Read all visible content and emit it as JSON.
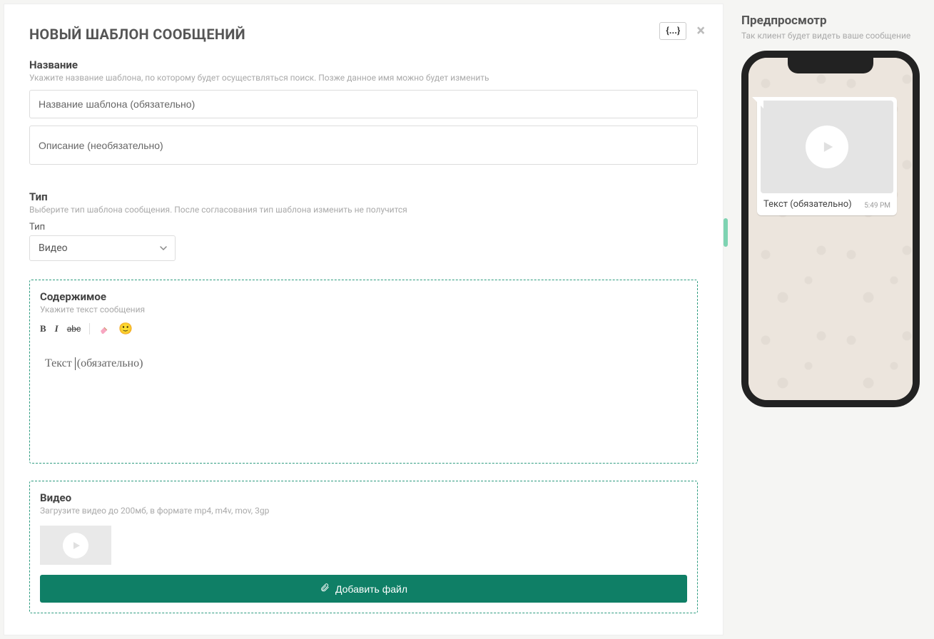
{
  "header": {
    "title": "НОВЫЙ ШАБЛОН СООБЩЕНИЙ",
    "json_button": "{...}"
  },
  "name_section": {
    "label": "Название",
    "hint": "Укажите название шаблона, по которому будет осуществляться поиск. Позже данное имя можно будет изменить",
    "placeholder": "Название шаблона (обязательно)",
    "desc_placeholder": "Описание (необязательно)"
  },
  "type_section": {
    "label": "Тип",
    "hint": "Выберите тип шаблона сообщения. После согласования тип шаблона изменить не получится",
    "select_label": "Тип",
    "value": "Видео"
  },
  "content_section": {
    "label": "Содержимое",
    "hint": "Укажите текст сообщения",
    "placeholder": "Текст (обязательно)",
    "toolbar": {
      "bold": "B",
      "italic": "I",
      "strike": "abc"
    }
  },
  "video_section": {
    "label": "Видео",
    "hint": "Загрузите видео до 200мб, в формате mp4, m4v, mov, 3gp",
    "button": "Добавить файл"
  },
  "preview": {
    "title": "Предпросмотр",
    "hint": "Так клиент будет видеть ваше сообщение",
    "bubble_text": "Текст (обязательно)",
    "time": "5:49 PM"
  }
}
